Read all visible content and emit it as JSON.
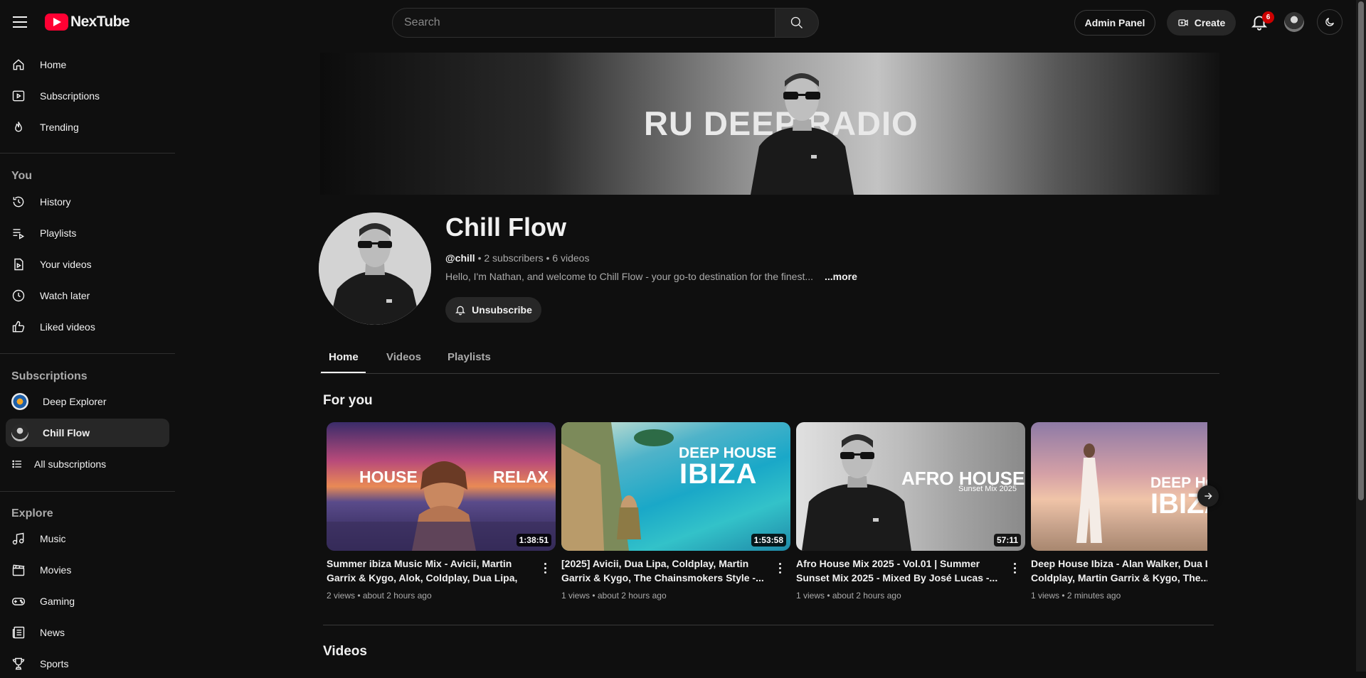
{
  "app": {
    "name": "NexTube"
  },
  "search": {
    "placeholder": "Search"
  },
  "header": {
    "admin_label": "Admin Panel",
    "create_label": "Create",
    "notification_count": "6"
  },
  "sidebar": {
    "main": [
      {
        "label": "Home",
        "icon": "home-icon"
      },
      {
        "label": "Subscriptions",
        "icon": "subscriptions-icon"
      },
      {
        "label": "Trending",
        "icon": "flame-icon"
      }
    ],
    "you_heading": "You",
    "you": [
      {
        "label": "History",
        "icon": "history-icon"
      },
      {
        "label": "Playlists",
        "icon": "playlist-icon"
      },
      {
        "label": "Your videos",
        "icon": "your-videos-icon"
      },
      {
        "label": "Watch later",
        "icon": "clock-icon"
      },
      {
        "label": "Liked videos",
        "icon": "thumbs-up-icon"
      }
    ],
    "subscriptions_heading": "Subscriptions",
    "subscriptions": [
      {
        "label": "Deep Explorer"
      },
      {
        "label": "Chill Flow"
      }
    ],
    "all_subscriptions": "All subscriptions",
    "explore_heading": "Explore",
    "explore": [
      {
        "label": "Music",
        "icon": "music-note-icon"
      },
      {
        "label": "Movies",
        "icon": "clapperboard-icon"
      },
      {
        "label": "Gaming",
        "icon": "gamepad-icon"
      },
      {
        "label": "News",
        "icon": "newspaper-icon"
      },
      {
        "label": "Sports",
        "icon": "trophy-icon"
      }
    ]
  },
  "channel": {
    "banner_text": "RU DEEP RADIO",
    "name": "Chill Flow",
    "handle": "@chill",
    "subscribers": "2 subscribers",
    "videos": "6 videos",
    "description": "Hello, I'm Nathan, and welcome to Chill Flow - your go-to destination for the finest...",
    "more_label": "...more",
    "unsubscribe_label": "Unsubscribe"
  },
  "tabs": [
    {
      "label": "Home"
    },
    {
      "label": "Videos"
    },
    {
      "label": "Playlists"
    }
  ],
  "for_you": {
    "title": "For you",
    "videos": [
      {
        "title": "Summer ibiza Music Mix - Avicii, Martin Garrix & Kygo, Alok, Coldplay, Dua Lipa, Ala...",
        "meta": "2 views • about 2 hours ago",
        "duration": "1:38:51",
        "thumb_left": "HOUSE",
        "thumb_right": "RELAX"
      },
      {
        "title": "[2025] Avicii, Dua Lipa, Coldplay, Martin Garrix & Kygo, The Chainsmokers Style -...",
        "meta": "1 views • about 2 hours ago",
        "duration": "1:53:58",
        "thumb_top": "DEEP HOUSE",
        "thumb_main": "IBIZA"
      },
      {
        "title": "Afro House Mix 2025 - Vol.01 | Summer Sunset Mix 2025 - Mixed By José Lucas -...",
        "meta": "1 views • about 2 hours ago",
        "duration": "57:11",
        "thumb_main": "AFRO HOUSE",
        "thumb_sub": "Sunset Mix 2025"
      },
      {
        "title": "Deep House Ibiza - Alan Walker, Dua Lipa, Coldplay, Martin Garrix & Kygo, The...",
        "meta": "1 views • 2 minutes ago",
        "thumb_top": "DEEP HOUSE",
        "thumb_main": "IBIZA"
      }
    ]
  },
  "videos_section": {
    "title": "Videos"
  },
  "colors": {
    "background": "#0f0f0f",
    "brand_red": "#ff0033",
    "badge_red": "#cc0000"
  }
}
